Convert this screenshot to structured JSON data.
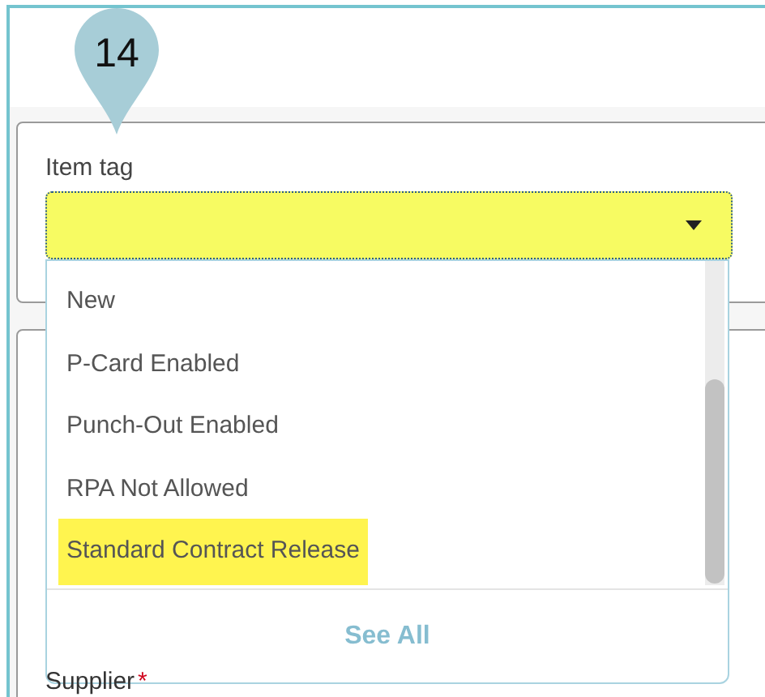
{
  "marker": {
    "label": "14"
  },
  "field": {
    "label": "Item tag",
    "open": true
  },
  "dropdown": {
    "options": [
      {
        "label": "New",
        "highlighted": false
      },
      {
        "label": "P-Card Enabled",
        "highlighted": false
      },
      {
        "label": "Punch-Out Enabled",
        "highlighted": false
      },
      {
        "label": "RPA Not Allowed",
        "highlighted": false
      },
      {
        "label": "Standard Contract Release",
        "highlighted": true
      }
    ],
    "footer": "See All"
  },
  "next_field": {
    "label": "Supplier",
    "required_mark": "*"
  }
}
